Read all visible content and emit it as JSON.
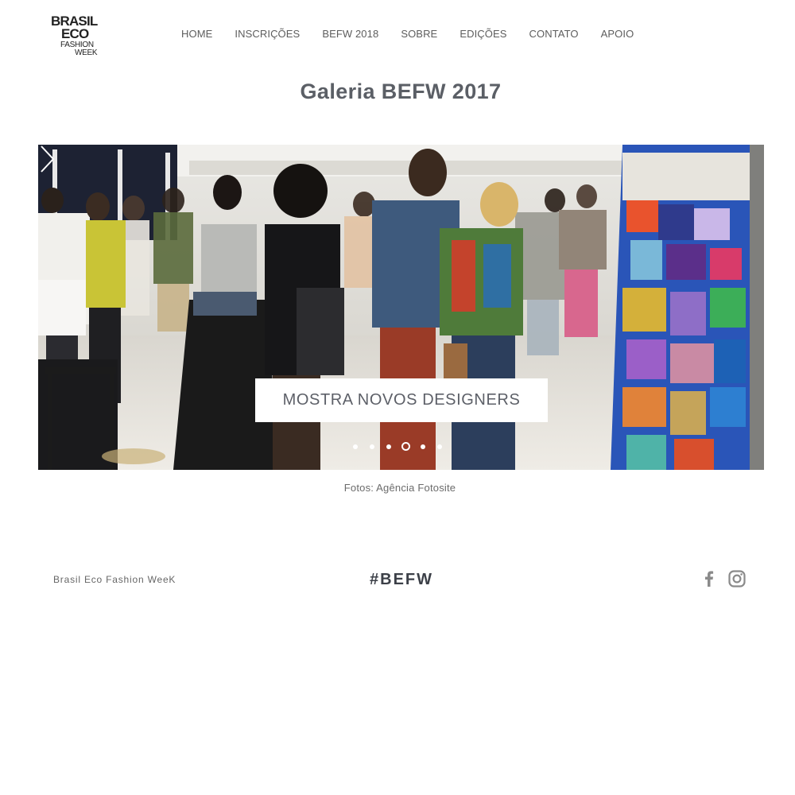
{
  "header": {
    "logo": {
      "line1": "BRASIL",
      "line2": "ECO",
      "line3": "FASHION",
      "line4": "WEEK"
    },
    "nav": [
      {
        "label": "HOME"
      },
      {
        "label": "INSCRIÇÕES"
      },
      {
        "label": "BEFW 2018"
      },
      {
        "label": "SOBRE"
      },
      {
        "label": "EDIÇÕES"
      },
      {
        "label": "CONTATO"
      },
      {
        "label": "APOIO"
      }
    ]
  },
  "main": {
    "title": "Galeria BEFW 2017",
    "slideshow": {
      "caption": "MOSTRA NOVOS DESIGNERS",
      "slide_count": 6,
      "active_slide": 4
    },
    "credits": "Fotos: Agência Fotosite"
  },
  "footer": {
    "brand": "Brasil Eco Fashion WeeK",
    "hashtag": "#BEFW",
    "social": [
      {
        "icon": "facebook-icon"
      },
      {
        "icon": "instagram-icon"
      }
    ]
  },
  "colors": {
    "title": "#5b5f66",
    "nav_text": "#5d5d5d",
    "hashtag": "#3c4048",
    "background": "#ffffff"
  }
}
